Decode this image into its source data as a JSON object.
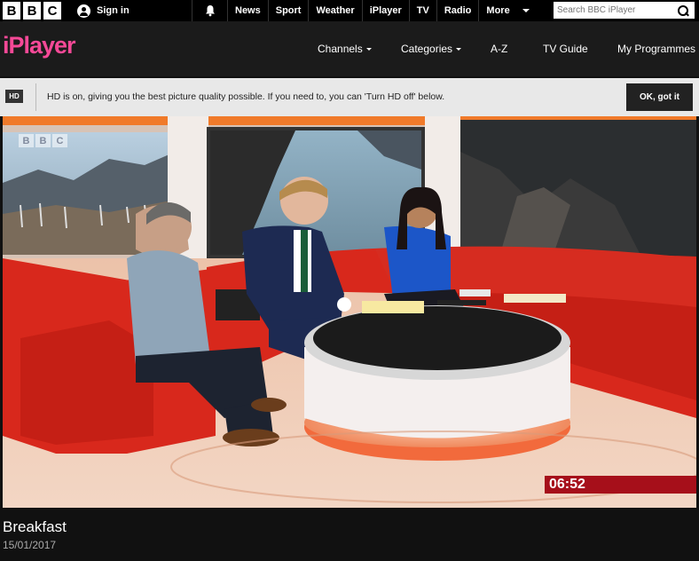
{
  "topbar": {
    "bbc_letters": [
      "B",
      "B",
      "C"
    ],
    "sign_in": "Sign in",
    "nav": [
      "News",
      "Sport",
      "Weather",
      "iPlayer",
      "TV",
      "Radio"
    ],
    "more": "More",
    "search_placeholder": "Search BBC iPlayer"
  },
  "iplayer": {
    "logo": "iPlayer",
    "nav": {
      "channels": "Channels",
      "categories": "Categories",
      "az": "A-Z",
      "tv_guide": "TV Guide",
      "my_programmes": "My Programmes"
    }
  },
  "hd_banner": {
    "badge": "HD",
    "message": "HD is on, giving you the best picture quality possible. If you need to, you can 'Turn HD off' below.",
    "button": "OK, got it"
  },
  "video": {
    "bbc_bug": [
      "B",
      "B",
      "C"
    ],
    "clock": "06:52"
  },
  "programme": {
    "title": "Breakfast",
    "date": "15/01/2017"
  },
  "colors": {
    "iplayer_pink": "#f54997",
    "clock_red": "#a60f1a",
    "sofa_red": "#d8281c"
  }
}
